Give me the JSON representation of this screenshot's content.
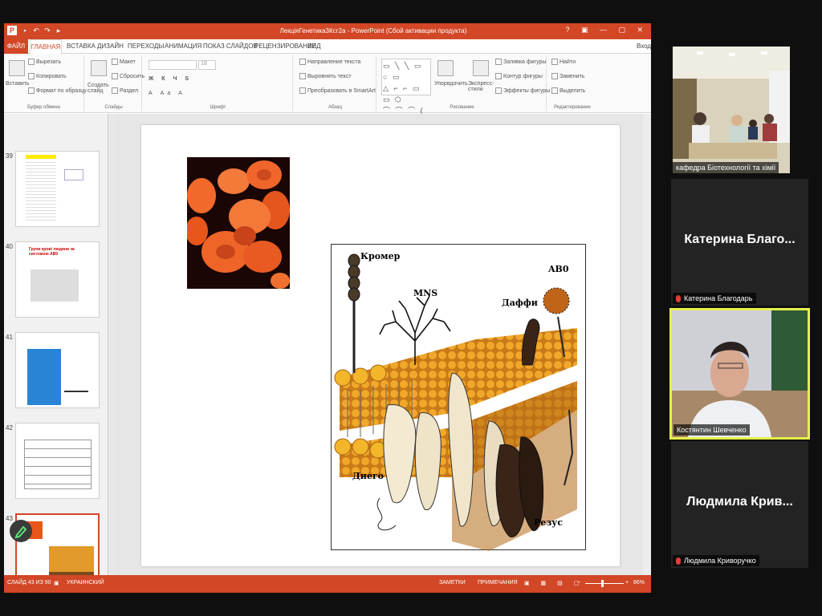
{
  "app": {
    "title": "ЛекціяГенетика3Ксг2а - PowerPoint (Сбой активации продукта)",
    "sign_in": "Вход"
  },
  "tabs": [
    "ФАЙЛ",
    "ГЛАВНАЯ",
    "ВСТАВКА",
    "ДИЗАЙН",
    "ПЕРЕХОДЫ",
    "АНИМАЦИЯ",
    "ПОКАЗ СЛАЙДОВ",
    "РЕЦЕНЗИРОВАНИЕ",
    "ВИД"
  ],
  "ribbon": {
    "groups": [
      "Буфер обмена",
      "Слайды",
      "Шрифт",
      "Абзац",
      "Рисование",
      "Редактирование"
    ],
    "clipboard": {
      "paste": "Вставить",
      "cut": "Вырезать",
      "copy": "Копировать",
      "format": "Формат по образцу"
    },
    "slides": {
      "new": "Создать слайд",
      "layout": "Макет",
      "reset": "Сбросить",
      "section": "Раздел"
    },
    "font": {
      "size": "18"
    },
    "paragraph": {
      "direction": "Направление текста",
      "align": "Выровнять текст",
      "smartart": "Преобразовать в SmartArt"
    },
    "drawing": {
      "arrange": "Упорядочить",
      "styles": "Экспресс-стили",
      "fill": "Заливка фигуры",
      "outline": "Контур фигуры",
      "effects": "Эффекты фигуры"
    },
    "editing": {
      "find": "Найти",
      "replace": "Заменить",
      "select": "Выделить"
    }
  },
  "thumbnails": [
    {
      "num": "39",
      "title": ""
    },
    {
      "num": "40",
      "title": "Групи крові людини за системою АВ0"
    },
    {
      "num": "41",
      "title": ""
    },
    {
      "num": "42",
      "title": ""
    },
    {
      "num": "43",
      "title": ""
    }
  ],
  "slide": {
    "labels": {
      "kromer": "Кромер",
      "mns": "MNS",
      "ab0": "AB0",
      "daffi": "Даффи",
      "diego": "Диего",
      "rhesus": "Резус"
    }
  },
  "status": {
    "slide": "СЛАЙД 43 ИЗ 90",
    "lang": "УКРАИНСКИЙ",
    "notes": "ЗАМЕТКИ",
    "comments": "ПРИМЕЧАНИЯ",
    "zoom": "86%"
  },
  "participants": [
    {
      "name": "кафедра Біотехнології та хімії",
      "big": ""
    },
    {
      "name": "Катерина Благодарь",
      "big": "Катерина  Благо..."
    },
    {
      "name": "Костянтин Шевченко",
      "big": ""
    },
    {
      "name": "Людмила Криворучко",
      "big": "Людмила  Крив..."
    }
  ],
  "colors": {
    "accent": "#d24726",
    "active_speaker": "#e6f04a"
  }
}
